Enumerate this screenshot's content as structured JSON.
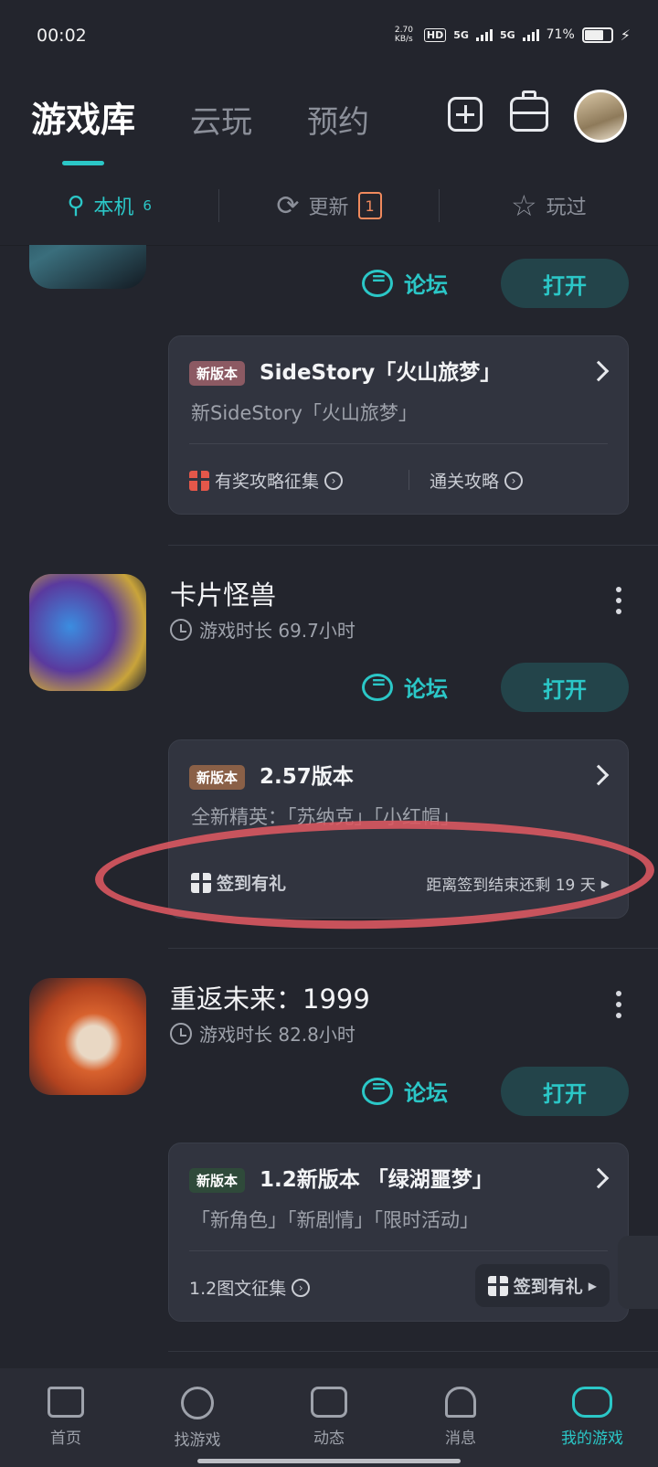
{
  "status": {
    "time": "00:02",
    "net_speed": "2.70 KB/s",
    "hd": "HD",
    "sim1": "5G",
    "sim2": "5G",
    "battery": "71%"
  },
  "header": {
    "tabs": [
      {
        "label": "游戏库"
      },
      {
        "label": "云玩"
      },
      {
        "label": "预约"
      }
    ]
  },
  "subtabs": {
    "local": {
      "label": "本机",
      "count": "6"
    },
    "update": {
      "label": "更新",
      "count": "1"
    },
    "played": {
      "label": "玩过"
    }
  },
  "games": [
    {
      "forum": "论坛",
      "open": "打开",
      "panel": {
        "tag": "新版本",
        "title": "SideStory「火山旅梦」",
        "subtitle": "新SideStory「火山旅梦」",
        "link1": "有奖攻略征集",
        "link2": "通关攻略"
      }
    },
    {
      "name": "卡片怪兽",
      "playtime": "游戏时长 69.7小时",
      "forum": "论坛",
      "open": "打开",
      "panel": {
        "tag": "新版本",
        "title": "2.57版本",
        "subtitle": "全新精英：「苏纳克」「小红帽」",
        "link1": "签到有礼",
        "link2": "距离签到结束还剩 19 天"
      }
    },
    {
      "name": "重返未来：1999",
      "playtime": "游戏时长 82.8小时",
      "forum": "论坛",
      "open": "打开",
      "panel": {
        "tag": "新版本",
        "title": "1.2新版本 「绿湖噩梦」",
        "subtitle": "「新角色」「新剧情」「限时活动」",
        "link1": "1.2图文征集",
        "link2": "签到有礼"
      }
    }
  ],
  "bottom_nav": [
    {
      "label": "首页"
    },
    {
      "label": "找游戏"
    },
    {
      "label": "动态"
    },
    {
      "label": "消息"
    },
    {
      "label": "我的游戏"
    }
  ],
  "colors": {
    "accent": "#2bc7c7",
    "bg": "#23252d",
    "panel": "#31343f",
    "update_badge": "#f08a5d",
    "highlight": "#d95861"
  }
}
